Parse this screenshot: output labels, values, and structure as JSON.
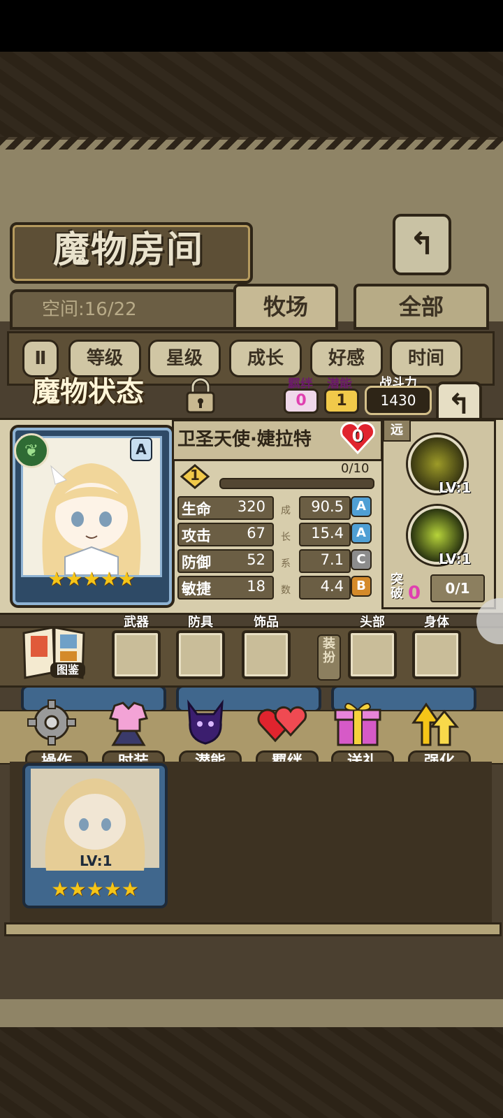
{
  "room": {
    "title": "魔物房间",
    "space": "空间:16/22",
    "tabs": [
      "牧场",
      "全部"
    ],
    "sort": {
      "toggle": "Ⅱ",
      "options": [
        "等级",
        "星级",
        "成长",
        "好感",
        "时间"
      ]
    }
  },
  "state": {
    "title": "魔物状态",
    "bond_label": "羁绊",
    "bond_value": "0",
    "potential_label": "潜能",
    "potential_value": "1",
    "power_label": "战斗力",
    "power_value": "1430",
    "monster": {
      "name": "卫圣天使·婕拉特",
      "heart_value": "0",
      "rank": "A",
      "star_count": 5,
      "level": "1",
      "exp": "0/10",
      "exp_fraction": 0.0
    },
    "growth_label": [
      "成",
      "长",
      "系",
      "数"
    ],
    "stats": [
      {
        "name": "生命",
        "value": "320",
        "growth": "90.5",
        "grade": "A"
      },
      {
        "name": "攻击",
        "value": "67",
        "growth": "15.4",
        "grade": "A"
      },
      {
        "name": "防御",
        "value": "52",
        "growth": "7.1",
        "grade": "C"
      },
      {
        "name": "敏捷",
        "value": "18",
        "growth": "4.4",
        "grade": "B"
      }
    ],
    "type_badge": "远",
    "skills": [
      {
        "level": "LV:1"
      },
      {
        "level": "LV:1"
      }
    ],
    "breakthrough_label": "突破",
    "breakthrough_value": "0",
    "breakthrough_progress": "0/1"
  },
  "equipment": {
    "book_label": "图鉴",
    "slots": [
      "武器",
      "防具",
      "饰品",
      "头部",
      "身体"
    ],
    "dressup_label": "装扮"
  },
  "actions": [
    "操作",
    "时装",
    "潜能",
    "羁绊",
    "送礼",
    "强化"
  ],
  "list": {
    "card_level": "LV:1"
  },
  "colors": {
    "grade_A": "#4f9fd4",
    "grade_B": "#d48a2a",
    "grade_C": "#8c8c8c",
    "pink_value": "#e040b0"
  }
}
